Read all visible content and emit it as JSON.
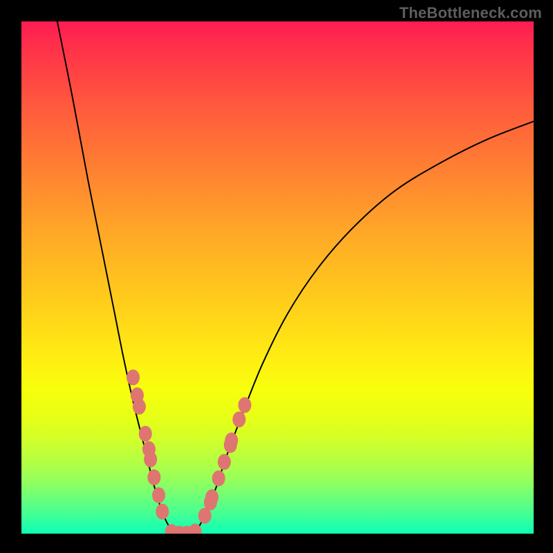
{
  "attribution": "TheBottleneck.com",
  "colors": {
    "frame": "#000000",
    "curve": "#000000",
    "marker_fill": "#DE7571",
    "attribution_text": "#5E5E5E"
  },
  "chart_data": {
    "type": "line",
    "title": "",
    "xlabel": "",
    "ylabel": "",
    "xlim": [
      0,
      100
    ],
    "ylim": [
      0,
      100
    ],
    "grid": false,
    "legend": false,
    "description": "Bottleneck curve: steep descend from top-left, minimum near x≈28–33, rising asymptotically toward the right.",
    "series": [
      {
        "name": "left_branch",
        "x": [
          7,
          10,
          13,
          16,
          18,
          20,
          22,
          24,
          26,
          28,
          30
        ],
        "y": [
          100,
          85,
          69,
          54,
          44,
          34,
          25,
          17,
          9,
          3,
          0
        ]
      },
      {
        "name": "valley",
        "x": [
          30,
          32,
          34
        ],
        "y": [
          0,
          0,
          0.5
        ]
      },
      {
        "name": "right_branch",
        "x": [
          34,
          36,
          38,
          40,
          43,
          47,
          52,
          58,
          65,
          73,
          82,
          91,
          100
        ],
        "y": [
          0.5,
          4,
          9,
          15,
          23,
          33,
          43,
          52,
          60,
          67,
          72.5,
          77,
          80.5
        ]
      }
    ],
    "markers": {
      "left_cluster": [
        {
          "x": 21.8,
          "y": 30.5
        },
        {
          "x": 22.6,
          "y": 27.0
        },
        {
          "x": 23.0,
          "y": 24.8
        },
        {
          "x": 24.2,
          "y": 19.5
        },
        {
          "x": 24.9,
          "y": 16.5
        },
        {
          "x": 25.2,
          "y": 14.5
        },
        {
          "x": 25.9,
          "y": 11.0
        },
        {
          "x": 26.8,
          "y": 7.5
        },
        {
          "x": 27.5,
          "y": 4.3
        }
      ],
      "bottom_cluster": [
        {
          "x": 29.3,
          "y": 0.3
        },
        {
          "x": 30.8,
          "y": 0.0
        },
        {
          "x": 32.3,
          "y": 0.0
        },
        {
          "x": 33.9,
          "y": 0.4
        }
      ],
      "right_cluster": [
        {
          "x": 35.8,
          "y": 3.5
        },
        {
          "x": 36.9,
          "y": 6.1
        },
        {
          "x": 37.2,
          "y": 7.1
        },
        {
          "x": 38.5,
          "y": 10.8
        },
        {
          "x": 39.6,
          "y": 14.0
        },
        {
          "x": 40.8,
          "y": 17.3
        },
        {
          "x": 41.0,
          "y": 18.2
        },
        {
          "x": 42.5,
          "y": 22.3
        },
        {
          "x": 43.6,
          "y": 25.1
        }
      ]
    }
  }
}
